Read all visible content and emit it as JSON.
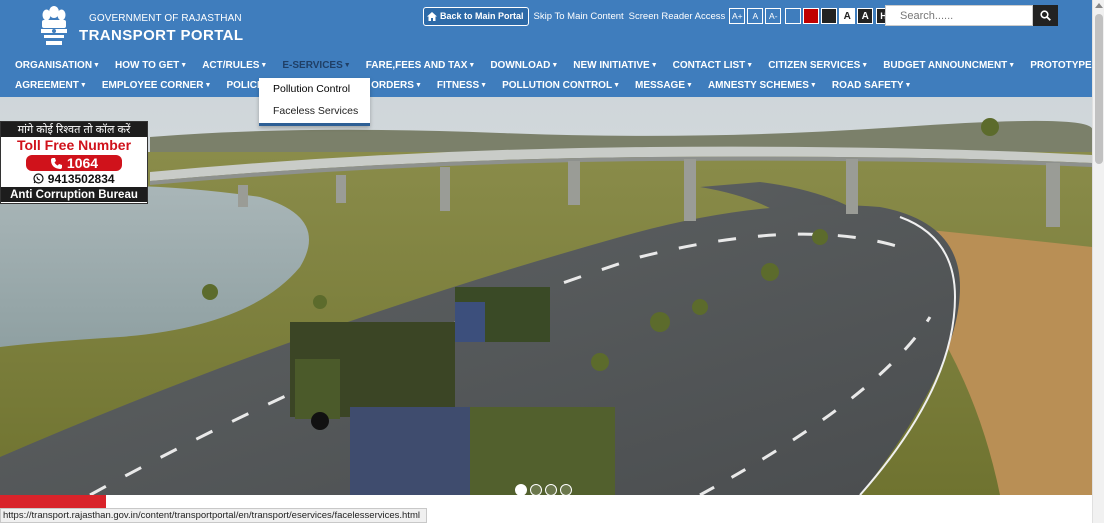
{
  "header": {
    "gov_text": "GOVERNMENT OF RAJASTHAN",
    "portal_title": "TRANSPORT PORTAL",
    "emblem_icon": "state-emblem-icon"
  },
  "utility": {
    "back_label": "Back to Main Portal",
    "skip_label": "Skip To Main Content",
    "screen_reader_label": "Screen Reader Access",
    "font_increase": "A+",
    "font_normal": "A",
    "font_decrease": "A-",
    "theme_colors": [
      "#3f7dbd",
      "#c00000",
      "#222222"
    ],
    "contrast_light": "A",
    "contrast_dark": "A",
    "language_label": "HINDI"
  },
  "search": {
    "placeholder": "Search......"
  },
  "nav": {
    "row1": [
      {
        "label": "ORGANISATION"
      },
      {
        "label": "HOW TO GET"
      },
      {
        "label": "ACT/RULES"
      },
      {
        "label": "E-SERVICES"
      },
      {
        "label": "FARE,FEES AND TAX"
      },
      {
        "label": "DOWNLOAD"
      },
      {
        "label": "NEW INITIATIVE"
      },
      {
        "label": "CONTACT LIST"
      },
      {
        "label": "CITIZEN SERVICES"
      },
      {
        "label": "BUDGET ANNOUNCMENT"
      },
      {
        "label": "PROTOTYPE"
      }
    ],
    "row2": [
      {
        "label": "AGREEMENT"
      },
      {
        "label": "EMPLOYEE CORNER"
      },
      {
        "label": "POLICIES"
      },
      {
        "label": "ORDERS"
      },
      {
        "label": "FITNESS"
      },
      {
        "label": "POLLUTION CONTROL"
      },
      {
        "label": "MESSAGE"
      },
      {
        "label": "AMNESTY SCHEMES"
      },
      {
        "label": "ROAD SAFETY"
      }
    ]
  },
  "dropdown": {
    "items": [
      {
        "label": "Pollution Control"
      },
      {
        "label": "Faceless Services"
      }
    ]
  },
  "anti_corruption": {
    "top_line": "मांगे कोई रिश्वत तो कॉल करें",
    "toll_label": "Toll Free Number",
    "number": "1064",
    "whatsapp": "9413502834",
    "bureau": "Anti Corruption Bureau"
  },
  "slider": {
    "dot_count": 4,
    "active_index": 0
  },
  "status_url": "https://transport.rajasthan.gov.in/content/transportportal/en/transport/eservices/facelesservices.html"
}
